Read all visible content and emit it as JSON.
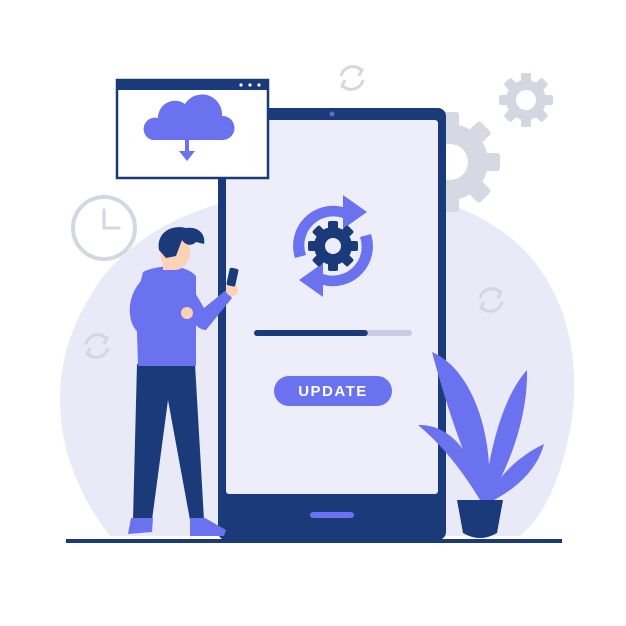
{
  "update_button": {
    "label": "UPDATE"
  },
  "progress": {
    "value": 0.72
  },
  "colors": {
    "primary": "#6a72f0",
    "navy": "#1b3a7a",
    "screen": "#eeeefb",
    "blob": "#e9e9f7",
    "gray_icon": "#d4d7e2"
  },
  "icons": [
    "cloud-download-icon",
    "clock-icon",
    "sync-gear-icon",
    "gear-icon",
    "refresh-icon",
    "plant",
    "person-with-phone"
  ]
}
